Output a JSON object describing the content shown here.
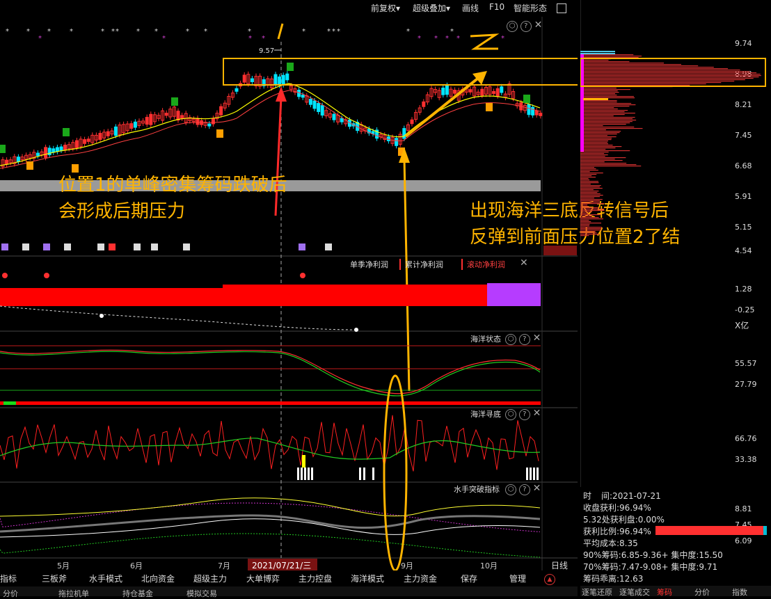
{
  "toolbar": {
    "restore_rights": "前复权",
    "super_overlay": "超级叠加",
    "draw_line": "画线",
    "f10": "F10",
    "smart_pattern": "智能形态"
  },
  "price_axis": [
    "9.74",
    "8.98",
    "8.21",
    "7.45",
    "6.68",
    "5.91",
    "5.15",
    "4.54"
  ],
  "peak_label": "9.57",
  "finance": {
    "legend_quarterly": "单季净利润",
    "legend_cumulative": "累计净利润",
    "legend_rolling": "滚动净利润",
    "axis_high": "1.28",
    "axis_low": "-0.25",
    "unit": "X亿"
  },
  "ocean_state": {
    "title": "海洋状态",
    "axis_high": "55.57",
    "axis_low": "27.79"
  },
  "ocean_bottom": {
    "title": "海洋寻底",
    "axis_high": "66.76",
    "axis_low": "33.38"
  },
  "breakout": {
    "title": "水手突破指标",
    "axis": [
      "8.81",
      "7.45",
      "6.09"
    ]
  },
  "time_axis": {
    "months": [
      "5月",
      "6月",
      "7月",
      "9月",
      "10月"
    ],
    "selected_date": "2021/07/21/三",
    "period": "日线"
  },
  "annotations": {
    "mark1": "1",
    "mark2": "Z",
    "left_line1": "位置1的单峰密集筹码跌破后",
    "left_line2": "会形成后期压力",
    "right_line1": "出现海洋三底反转信号后",
    "right_line2": "反弹到前面压力位置2了结"
  },
  "bottom_tabs": [
    "指标",
    "三板斧",
    "水手模式",
    "北向资金",
    "超级主力",
    "大单博弈",
    "主力控盘",
    "海洋模式",
    "主力资金",
    "保存",
    "管理"
  ],
  "bottom_tabs2": [
    "分价",
    "拖拉机单",
    "持仓基金",
    "模拟交易"
  ],
  "chip_panel": {
    "time_label": "时",
    "time_value": "间:2021-07-21",
    "profit_ratio_line": "收盘获利:96.94%",
    "profit_level_line": "5.32处获利盘:0.00%",
    "profit_ratio_label": "获利比例:96.94%",
    "profit_ratio_value": 0.9694,
    "avg_cost": "平均成本:8.35",
    "chip90": "90%筹码:6.85-9.36+ 集中度:15.50",
    "chip70": "70%筹码:7.47-9.08+ 集中度:9.71",
    "chip_diverge": "筹码乖离:12.63",
    "tabs": [
      "逐笔还原",
      "逐笔成交",
      "筹码",
      "分价",
      "指数"
    ]
  },
  "colors": {
    "up": "#ff3030",
    "down": "#00e5ff",
    "accent": "#ffb400",
    "ma": "#ffff00"
  }
}
